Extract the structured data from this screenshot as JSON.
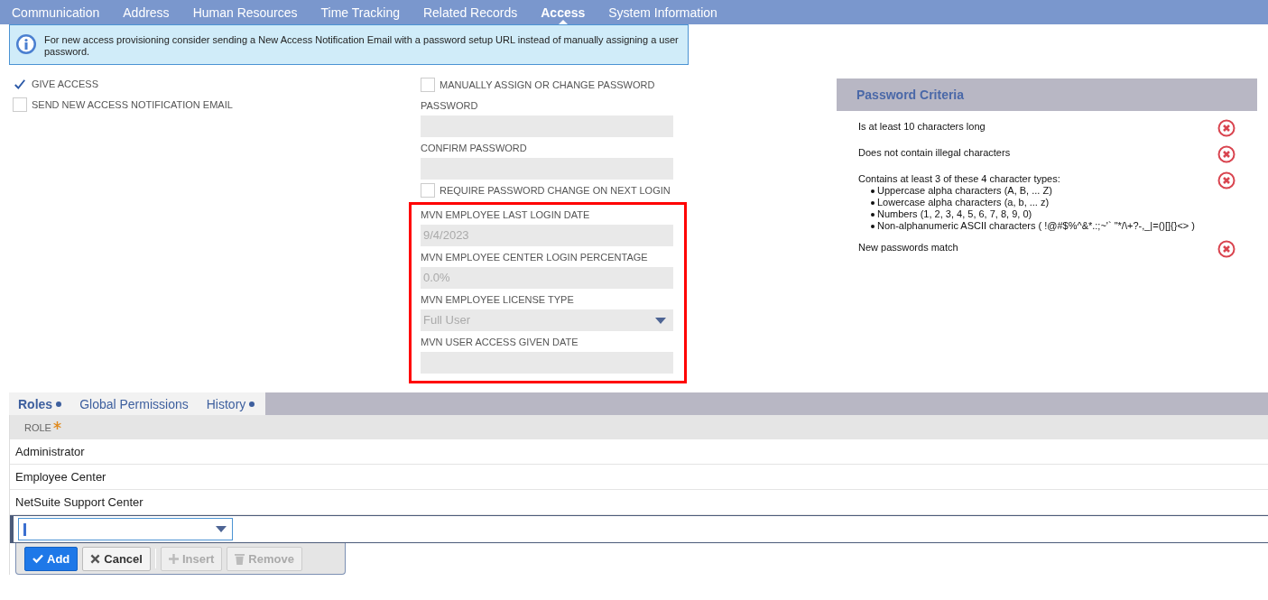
{
  "tabs": [
    {
      "label": "Communication",
      "selected": false
    },
    {
      "label": "Address",
      "selected": false
    },
    {
      "label": "Human Resources",
      "selected": false
    },
    {
      "label": "Time Tracking",
      "selected": false
    },
    {
      "label": "Related Records",
      "selected": false
    },
    {
      "label": "Access",
      "selected": true
    },
    {
      "label": "System Information",
      "selected": false
    }
  ],
  "notice": {
    "text": "For new access provisioning consider sending a New Access Notification Email with a password setup URL instead of manually assigning a user password."
  },
  "access_options": [
    {
      "label": "GIVE ACCESS",
      "checked": true
    },
    {
      "label": "SEND NEW ACCESS NOTIFICATION EMAIL",
      "checked": false
    }
  ],
  "password_form": [
    {
      "kind": "checkbox",
      "label": "MANUALLY ASSIGN OR CHANGE PASSWORD",
      "checked": false
    },
    {
      "kind": "field",
      "label": "PASSWORD"
    },
    {
      "kind": "field",
      "label": "CONFIRM PASSWORD"
    },
    {
      "kind": "checkbox",
      "label": "REQUIRE PASSWORD CHANGE ON NEXT LOGIN",
      "checked": false
    }
  ],
  "highlighted_fields": [
    {
      "kind": "field",
      "label": "MVN EMPLOYEE LAST LOGIN DATE",
      "value": "9/4/2023"
    },
    {
      "kind": "field",
      "label": "MVN EMPLOYEE CENTER LOGIN PERCENTAGE",
      "value": "0.0%"
    },
    {
      "kind": "select",
      "label": "MVN EMPLOYEE LICENSE TYPE",
      "value": "Full User"
    },
    {
      "kind": "field",
      "label": "MVN USER ACCESS GIVEN DATE"
    }
  ],
  "password_criteria": {
    "title": "Password Criteria",
    "items": [
      {
        "text": "Is at least 10 characters long",
        "met": false
      },
      {
        "text": "Does not contain illegal characters",
        "met": false
      },
      {
        "text": "Contains at least 3 of these 4 character types:",
        "met": false,
        "bullets": [
          "Uppercase alpha characters (A, B, ... Z)",
          "Lowercase alpha characters (a, b, ... z)",
          "Numbers (1, 2, 3, 4, 5, 6, 7, 8, 9, 0)",
          "Non-alphanumeric ASCII characters ( !@#$%^&*.:;~'`  \"*/\\+?-,_|=()[]{}<> )"
        ]
      },
      {
        "text": "New passwords match",
        "met": false
      }
    ]
  },
  "subtabs": [
    {
      "label": "Roles",
      "selected": true,
      "has_data": true
    },
    {
      "label": "Global Permissions",
      "selected": false,
      "has_data": false
    },
    {
      "label": "History",
      "selected": false,
      "has_data": true
    }
  ],
  "roles_table": {
    "column": "ROLE",
    "required": true,
    "rows": [
      "Administrator",
      "Employee Center",
      "NetSuite Support Center"
    ]
  },
  "row_buttons": [
    {
      "label": "Add",
      "kind": "primary",
      "disabled": false
    },
    {
      "label": "Cancel",
      "kind": "cancel",
      "disabled": false
    },
    {
      "label": "Insert",
      "kind": "insert",
      "disabled": true
    },
    {
      "label": "Remove",
      "kind": "remove",
      "disabled": true
    }
  ]
}
